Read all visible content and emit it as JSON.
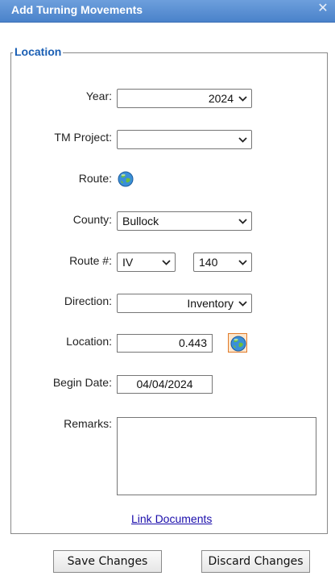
{
  "dialog": {
    "title": "Add Turning Movements",
    "close_icon": "close-icon"
  },
  "section": {
    "legend": "Location"
  },
  "fields": {
    "year": {
      "label": "Year:",
      "value": "2024"
    },
    "tm_project": {
      "label": "TM Project:",
      "value": ""
    },
    "route": {
      "label": "Route:",
      "icon": "globe-icon"
    },
    "county": {
      "label": "County:",
      "value": "Bullock"
    },
    "route_num": {
      "label": "Route #:",
      "prefix_value": "IV",
      "number_value": "140"
    },
    "direction": {
      "label": "Direction:",
      "value": "Inventory"
    },
    "location": {
      "label": "Location:",
      "value": "0.443",
      "icon": "globe-icon"
    },
    "begin_date": {
      "label": "Begin Date:",
      "value": "04/04/2024"
    },
    "remarks": {
      "label": "Remarks:",
      "value": ""
    }
  },
  "links": {
    "link_documents": "Link Documents"
  },
  "buttons": {
    "save": "Save Changes",
    "discard": "Discard Changes"
  },
  "colors": {
    "titlebar": "#5a8fd4",
    "legend": "#1a5fb4",
    "link": "#1a0dab",
    "globe_button_border": "#e07a2a"
  }
}
